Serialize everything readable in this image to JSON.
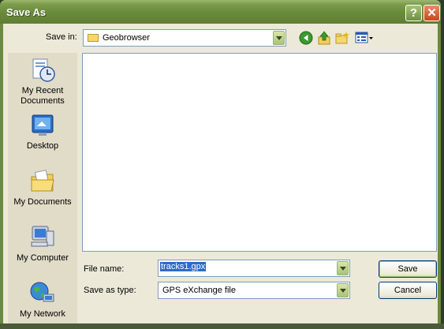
{
  "window": {
    "title": "Save As"
  },
  "titlebar": {
    "help_glyph": "?",
    "close_glyph": "✕"
  },
  "toolbar": {
    "save_in_label": "Save in:",
    "save_in_value": "Geobrowser",
    "icons": [
      "back-icon",
      "up-folder-icon",
      "new-folder-icon",
      "view-menu-icon"
    ]
  },
  "places": [
    {
      "name": "my-recent-documents",
      "label": "My Recent Documents",
      "icon": "recent-documents-icon"
    },
    {
      "name": "desktop",
      "label": "Desktop",
      "icon": "desktop-icon"
    },
    {
      "name": "my-documents",
      "label": "My Documents",
      "icon": "my-documents-icon"
    },
    {
      "name": "my-computer",
      "label": "My Computer",
      "icon": "my-computer-icon"
    },
    {
      "name": "my-network",
      "label": "My Network",
      "icon": "my-network-icon"
    }
  ],
  "form": {
    "file_name_label": "File name:",
    "file_name_value": "tracks1.gpx",
    "save_as_type_label": "Save as type:",
    "save_as_type_value": "GPS eXchange file"
  },
  "buttons": {
    "save": "Save",
    "cancel": "Cancel"
  },
  "colors": {
    "titlebar": "#6a8a3b",
    "dialog_bg": "#ece9d8",
    "selection": "#316ac5"
  }
}
